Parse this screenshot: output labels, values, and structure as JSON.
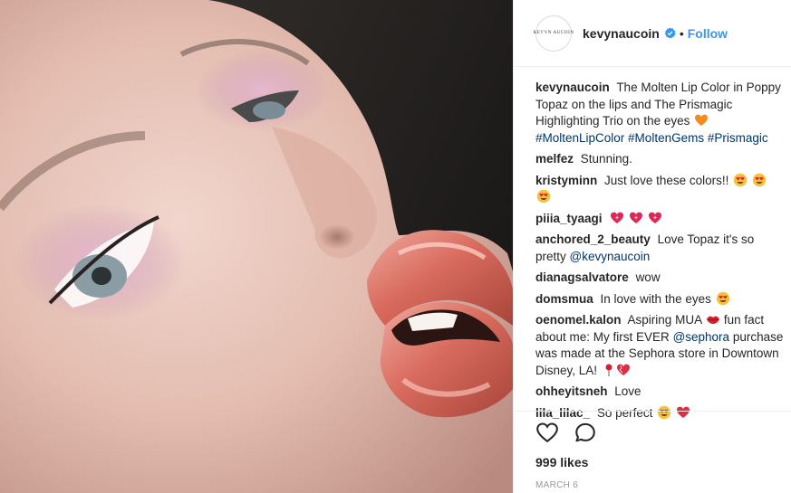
{
  "post": {
    "image_alt": "Close-up portrait wearing pink eyeshadow and metallic coral lip gloss"
  },
  "header": {
    "avatar_text": "KEVYN AUCOIN",
    "username": "kevynaucoin",
    "verified_icon": "verified-badge-icon",
    "separator": "•",
    "follow_label": "Follow"
  },
  "caption": {
    "user": "kevynaucoin",
    "text": "The Molten Lip Color in Poppy Topaz on the lips and The Prismagic Highlighting Trio on the eyes",
    "emoji": "orange-heart",
    "hashtags": "#MoltenLipColor #MoltenGems #Prismagic"
  },
  "comments": [
    {
      "user": "melfez",
      "text": "Stunning."
    },
    {
      "user": "kristyminn",
      "text": "Just love these colors!!"
    },
    {
      "user": "piiia_tyaagi",
      "text": ""
    },
    {
      "user": "anchored_2_beauty",
      "text": "Love Topaz it's so pretty",
      "mention": "@kevynaucoin"
    },
    {
      "user": "dianagsalvatore",
      "text": "wow"
    },
    {
      "user": "domsmua",
      "text": "In love with the eyes"
    },
    {
      "user": "oenomel.kalon",
      "text": "Aspiring MUA",
      "text2": "fun fact about me: My first EVER",
      "mention": "@sephora",
      "text3": "purchase was made at the Sephora store in Downtown Disney, LA!"
    },
    {
      "user": "ohheyitsneh",
      "text": "Love"
    },
    {
      "user": "lila_lilac_",
      "text": "So perfect"
    }
  ],
  "actions": {
    "like_icon": "heart-outline-icon",
    "comment_icon": "speech-bubble-icon",
    "likes_text": "999 likes",
    "date": "MARCH 6"
  },
  "colors": {
    "link": "#3897f0",
    "mention": "#003569",
    "text": "#262626",
    "muted": "#999999",
    "divider": "#efefef"
  }
}
